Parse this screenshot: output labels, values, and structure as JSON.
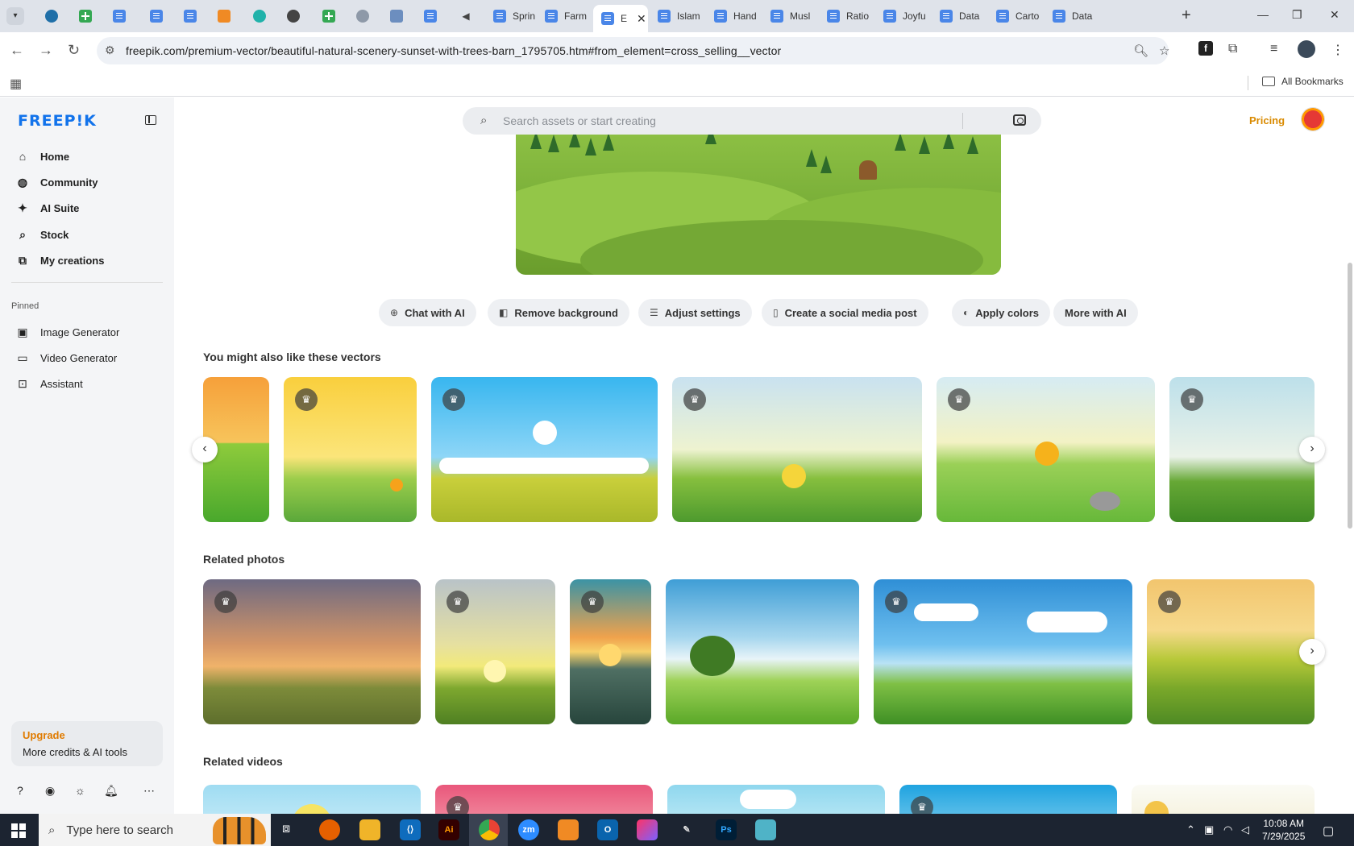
{
  "browser": {
    "tabs": [
      {
        "title": "",
        "icon": "wordpress-icon"
      },
      {
        "title": "",
        "icon": "sheets-icon"
      },
      {
        "title": "",
        "icon": "docs-icon"
      },
      {
        "title": "",
        "icon": "docs-icon"
      },
      {
        "title": "",
        "icon": "docs-icon"
      },
      {
        "title": "",
        "icon": "orange-app-icon"
      },
      {
        "title": "",
        "icon": "teal-app-icon"
      },
      {
        "title": "",
        "icon": "openai-icon"
      },
      {
        "title": "",
        "icon": "sheets-icon"
      },
      {
        "title": "",
        "icon": "globe-icon"
      },
      {
        "title": "",
        "icon": "grid-app-icon"
      },
      {
        "title": "",
        "icon": "docs-icon"
      },
      {
        "title": "",
        "icon": "speaker-icon"
      },
      {
        "title": "Sprin",
        "icon": "docs-icon"
      },
      {
        "title": "Farm",
        "icon": "docs-icon"
      },
      {
        "title": "E",
        "icon": "docs-icon",
        "active": true
      },
      {
        "title": "Islam",
        "icon": "docs-icon"
      },
      {
        "title": "Hand",
        "icon": "docs-icon"
      },
      {
        "title": "Musl",
        "icon": "docs-icon"
      },
      {
        "title": "Ratio",
        "icon": "docs-icon"
      },
      {
        "title": "Joyfu",
        "icon": "docs-icon"
      },
      {
        "title": "Data",
        "icon": "docs-icon"
      },
      {
        "title": "Carto",
        "icon": "docs-icon"
      },
      {
        "title": "Data",
        "icon": "docs-icon"
      }
    ],
    "url": "freepik.com/premium-vector/beautiful-natural-scenery-sunset-with-trees-barn_1795705.htm#from_element=cross_selling__vector",
    "bookmarks_label": "All Bookmarks"
  },
  "sidebar": {
    "logo": "FREEP!K",
    "nav": [
      {
        "label": "Home",
        "icon": "home-icon"
      },
      {
        "label": "Community",
        "icon": "globe-icon"
      },
      {
        "label": "AI Suite",
        "icon": "sparkle-icon"
      },
      {
        "label": "Stock",
        "icon": "search-icon"
      },
      {
        "label": "My creations",
        "icon": "creations-icon"
      }
    ],
    "pinned_label": "Pinned",
    "pinned": [
      {
        "label": "Image Generator",
        "icon": "image-icon"
      },
      {
        "label": "Video Generator",
        "icon": "video-icon"
      },
      {
        "label": "Assistant",
        "icon": "assistant-icon"
      }
    ],
    "upgrade": {
      "title": "Upgrade",
      "desc": "More credits & AI tools"
    }
  },
  "header": {
    "search_placeholder": "Search assets or start creating",
    "pricing": "Pricing"
  },
  "actions": [
    {
      "label": "Chat with AI",
      "icon": "chat-icon"
    },
    {
      "label": "Remove background",
      "icon": "remove-bg-icon"
    },
    {
      "label": "Adjust settings",
      "icon": "sliders-icon"
    },
    {
      "label": "Create a social media post",
      "icon": "phone-icon"
    },
    {
      "label": "Apply colors",
      "icon": "palette-icon"
    },
    {
      "label": "More with AI",
      "icon": ""
    }
  ],
  "sections": {
    "vectors": "You might also like these vectors",
    "photos": "Related photos",
    "videos": "Related videos"
  },
  "taskbar": {
    "search_placeholder": "Type here to search",
    "time": "10:08 AM",
    "date": "7/29/2025"
  },
  "colors": {
    "brand": "#1273eb",
    "pricing": "#d98a00",
    "upgrade": "#e07b00"
  }
}
